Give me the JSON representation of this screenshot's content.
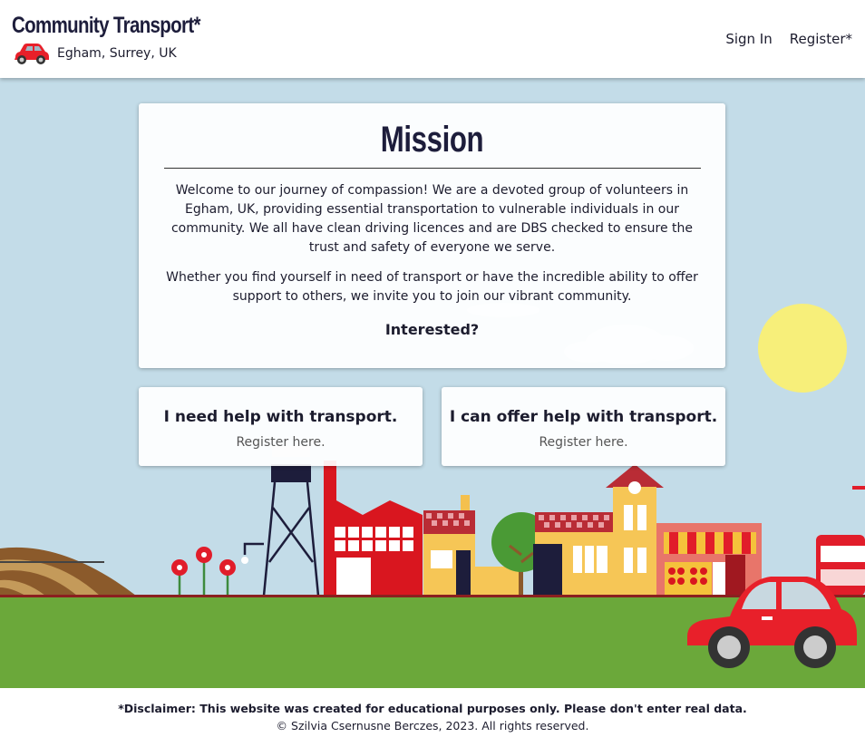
{
  "header": {
    "title": "Community Transport*",
    "location": "Egham, Surrey, UK",
    "nav": {
      "sign_in": "Sign In",
      "register": "Register*"
    }
  },
  "mission": {
    "heading": "Mission",
    "paragraph1": "Welcome to our journey of compassion! We are a devoted group of volunteers in Egham, UK, providing essential transportation to vulnerable individuals in our community. We all have clean driving licences and are DBS checked to ensure the trust and safety of everyone we serve.",
    "paragraph2": "Whether you find yourself in need of transport or have the incredible ability to offer support to others, we invite you to join our vibrant community.",
    "prompt": "Interested?"
  },
  "cta": {
    "need": {
      "title": "I need help with transport.",
      "sub": "Register here."
    },
    "offer": {
      "title": "I can offer help with transport.",
      "sub": "Register here."
    }
  },
  "footer": {
    "disclaimer": "*Disclaimer: This website was created for educational purposes only. Please don't enter real data.",
    "copyright": "© Szilvia Csernusne Berczes, 2023. All rights reserved."
  },
  "colors": {
    "sky": "#c3dce8",
    "grass": "#6ba83a",
    "sun": "#f7ef7a",
    "car": "#e8202a",
    "navy": "#1d1d3b"
  },
  "icons": [
    "car-logo-icon"
  ]
}
